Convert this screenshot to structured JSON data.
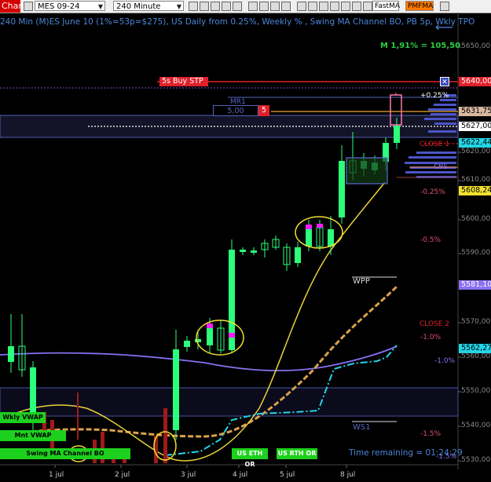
{
  "toolbar": {
    "chart_label": "Chart",
    "symbol_select": "MES 09-24",
    "interval_select": "240 Minute",
    "fast_ma": "FastMA",
    "pmf_ma": "PMFMA"
  },
  "title": "240 Min (M)ES June 10 (1%=53p=$275), US Daily from 0.25%, Weekly % , Swing MA Channel BO, PB 5p, Wkly TPO",
  "m_label": "M 1,91% = 105,50",
  "order": {
    "buy_stop_label": "5s  Buy STP",
    "price_box": "5,00",
    "qty_box": "5"
  },
  "right_tags": {
    "buy_stop": "5640,00",
    "tpo_high": "5631,75",
    "last_white": "5627,00",
    "last_price": "5622,44",
    "yellow_level": "5608,24",
    "purple_level": "5581,10",
    "cyan_level": "5562,27"
  },
  "price_axis": [
    "5650,00",
    "5620,00",
    "5610,00",
    "5600,00",
    "5590,00",
    "5570,00",
    "5560,00",
    "5550,00",
    "5540,00",
    "5530,00"
  ],
  "x_axis": [
    "1 jul",
    "2 jul",
    "3 jul",
    "4 jul",
    "5 jul",
    "8 jul"
  ],
  "labels": {
    "mr1": "MR1",
    "close1": "CLOSE 1",
    "close2": "CLOSE 2",
    "wpp": "WPP",
    "ws1": "WS1",
    "cbs": "CBS",
    "pct_p025": "+0.25%",
    "pct_m025": "-0.25%",
    "pct_m05": "-0.5%",
    "pct_m1": "-1.0%",
    "pct_m1b": "-1.0%",
    "pct_m15": "-1.5%",
    "pct_m15b": "-1.5%",
    "time_remaining": "Time remaining = 01:24:29"
  },
  "buttons": {
    "wkly_vwap": "Wkly VWAP",
    "mnt_vwap": "Mnt VWAP",
    "swing_ma": "Swing MA Channel BO",
    "us_eth": "US ETH OR",
    "us_rth": "US RTH OR"
  },
  "colors": {
    "up_candle": "#2cff7a",
    "down_candle": "#2cff7a",
    "buy_stop": "#e0202a",
    "vwap_purple": "#8a6ff0",
    "cyan_line": "#23d5e8",
    "ma_yellow": "#e8d23a",
    "ma_orange": "#d9a24a"
  }
}
